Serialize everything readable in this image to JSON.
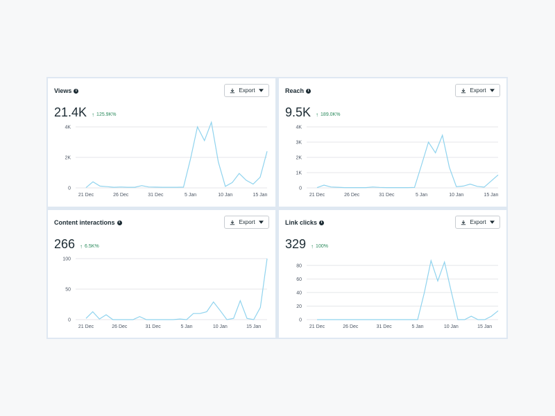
{
  "cards": [
    {
      "title": "Views",
      "export_label": "Export",
      "value": "21.4K",
      "change": "125.9K%",
      "chart_data": {
        "type": "line",
        "x_tick_labels": [
          "21 Dec",
          "26 Dec",
          "31 Dec",
          "5 Jan",
          "10 Jan",
          "15 Jan"
        ],
        "y_tick_labels": [
          "0",
          "2K",
          "4K"
        ],
        "ylim": [
          0,
          4000
        ],
        "series": [
          {
            "color": "#8fd3ee",
            "values": [
              20,
              400,
              120,
              80,
              40,
              60,
              40,
              40,
              150,
              60,
              50,
              40,
              40,
              40,
              50,
              1900,
              4000,
              3100,
              4300,
              1700,
              100,
              350,
              950,
              500,
              250,
              700,
              2400
            ]
          }
        ],
        "grid": true
      }
    },
    {
      "title": "Reach",
      "export_label": "Export",
      "value": "9.5K",
      "change": "189.0K%",
      "chart_data": {
        "type": "line",
        "x_tick_labels": [
          "21 Dec",
          "26 Dec",
          "31 Dec",
          "5 Jan",
          "10 Jan",
          "15 Jan"
        ],
        "y_tick_labels": [
          "0",
          "1K",
          "2K",
          "3K",
          "4K"
        ],
        "ylim": [
          0,
          4000
        ],
        "series": [
          {
            "color": "#8fd3ee",
            "values": [
              20,
              180,
              60,
              40,
              20,
              20,
              20,
              20,
              60,
              30,
              20,
              20,
              20,
              20,
              30,
              1500,
              3000,
              2300,
              3450,
              1350,
              80,
              120,
              250,
              100,
              50,
              450,
              850
            ]
          }
        ],
        "grid": true
      }
    },
    {
      "title": "Content interactions",
      "export_label": "Export",
      "value": "266",
      "change": "6.5K%",
      "chart_data": {
        "type": "line",
        "x_tick_labels": [
          "21 Dec",
          "26 Dec",
          "31 Dec",
          "5 Jan",
          "10 Jan",
          "15 Jan"
        ],
        "y_tick_labels": [
          "0",
          "50",
          "100"
        ],
        "ylim": [
          0,
          100
        ],
        "series": [
          {
            "color": "#8fd3ee",
            "values": [
              2,
              13,
              1,
              8,
              0,
              0,
              0,
              0,
              5,
              0,
              0,
              0,
              0,
              0,
              1,
              0,
              10,
              10,
              13,
              29,
              15,
              0,
              2,
              31,
              2,
              0,
              20,
              100
            ]
          }
        ],
        "grid": true
      }
    },
    {
      "title": "Link clicks",
      "export_label": "Export",
      "value": "329",
      "change": "100%",
      "chart_data": {
        "type": "line",
        "x_tick_labels": [
          "21 Dec",
          "26 Dec",
          "31 Dec",
          "5 Jan",
          "10 Jan",
          "15 Jan"
        ],
        "y_tick_labels": [
          "0",
          "20",
          "40",
          "60",
          "80"
        ],
        "ylim": [
          0,
          90
        ],
        "series": [
          {
            "color": "#8fd3ee",
            "values": [
              0,
              0,
              0,
              0,
              0,
              0,
              0,
              0,
              0,
              0,
              0,
              0,
              0,
              0,
              0,
              0,
              40,
              87,
              57,
              85,
              42,
              0,
              0,
              5,
              0,
              0,
              5,
              13
            ]
          }
        ],
        "grid": true
      }
    }
  ]
}
